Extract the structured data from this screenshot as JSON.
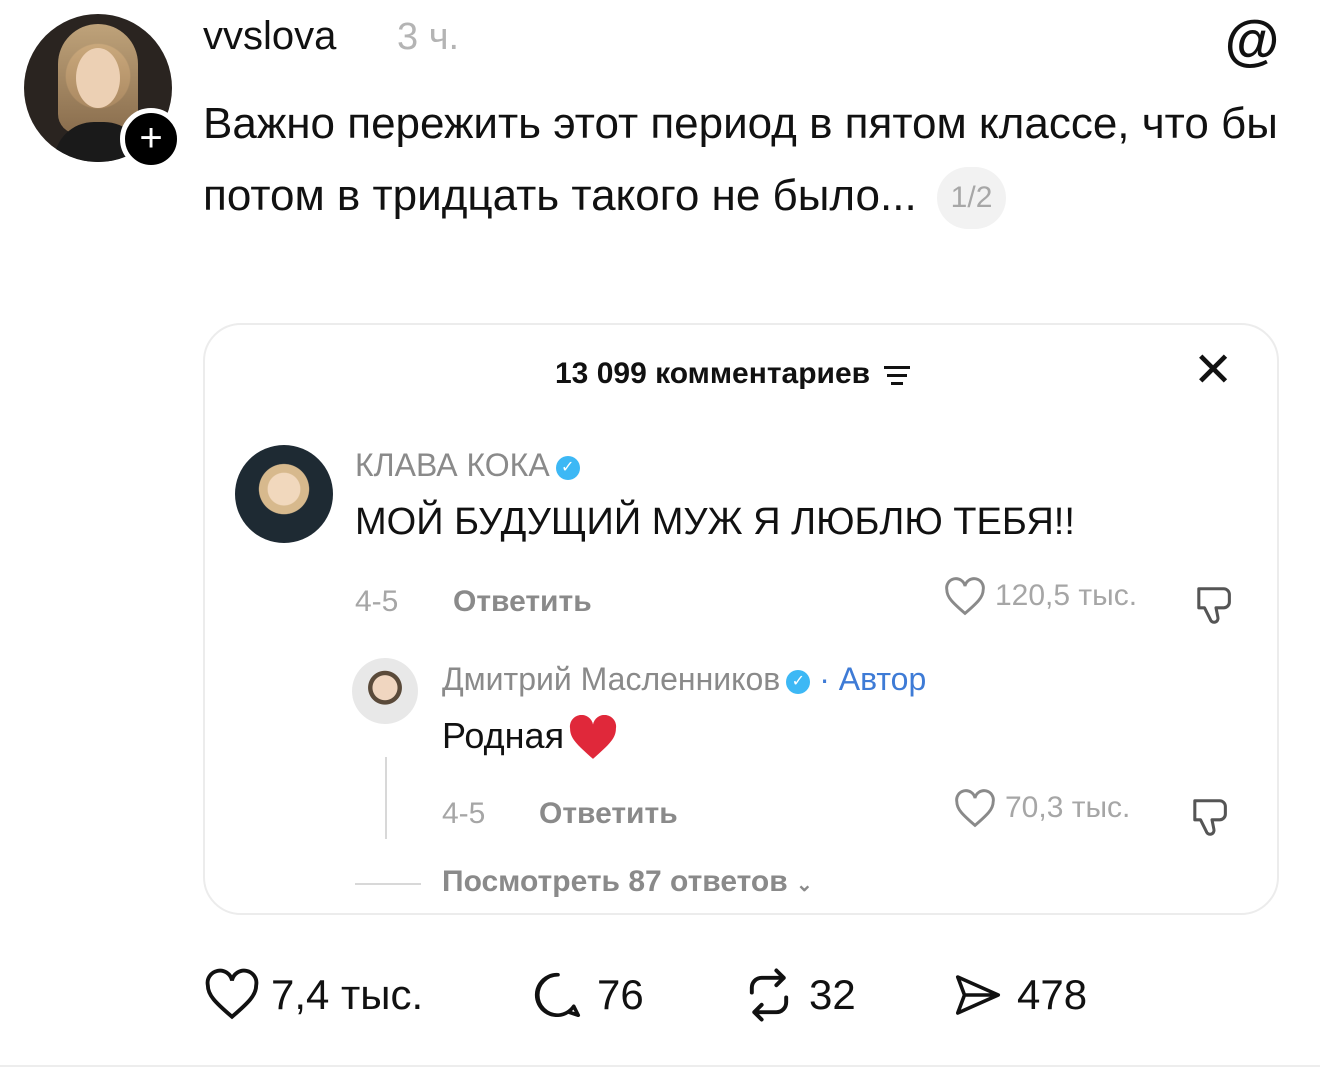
{
  "post": {
    "username": "vvslova",
    "time": "3 ч.",
    "text": "Важно пережить этот период в пятом классе, что бы потом в тридцать такого не было...",
    "page_indicator": "1/2"
  },
  "quoted_card": {
    "header": "13 099 комментариев",
    "comment": {
      "author": "КЛАВА КОКА",
      "text": "МОЙ БУДУЩИЙ МУЖ Я ЛЮБЛЮ ТЕБЯ!!",
      "date": "4-5",
      "reply_label": "Ответить",
      "likes": "120,5 тыс."
    },
    "reply": {
      "author": "Дмитрий Масленников",
      "author_tag": "· Автор",
      "text": "Родная",
      "date": "4-5",
      "reply_label": "Ответить",
      "likes": "70,3 тыс."
    },
    "view_replies": "Посмотреть 87 ответов"
  },
  "actions": {
    "likes": "7,4 тыс.",
    "comments": "76",
    "reposts": "32",
    "shares": "478"
  },
  "icons": {
    "threads": "threads-logo-icon",
    "follow": "plus-icon",
    "close": "close-icon",
    "filter": "filter-icon",
    "verified": "verified-icon",
    "like": "heart-icon",
    "dislike": "thumbs-down-icon",
    "comment": "comment-icon",
    "repost": "repost-icon",
    "share": "send-icon"
  },
  "colors": {
    "verified": "#3db8f5",
    "author_tag": "#3e7bd6",
    "muted_text": "#a6a6a6"
  }
}
